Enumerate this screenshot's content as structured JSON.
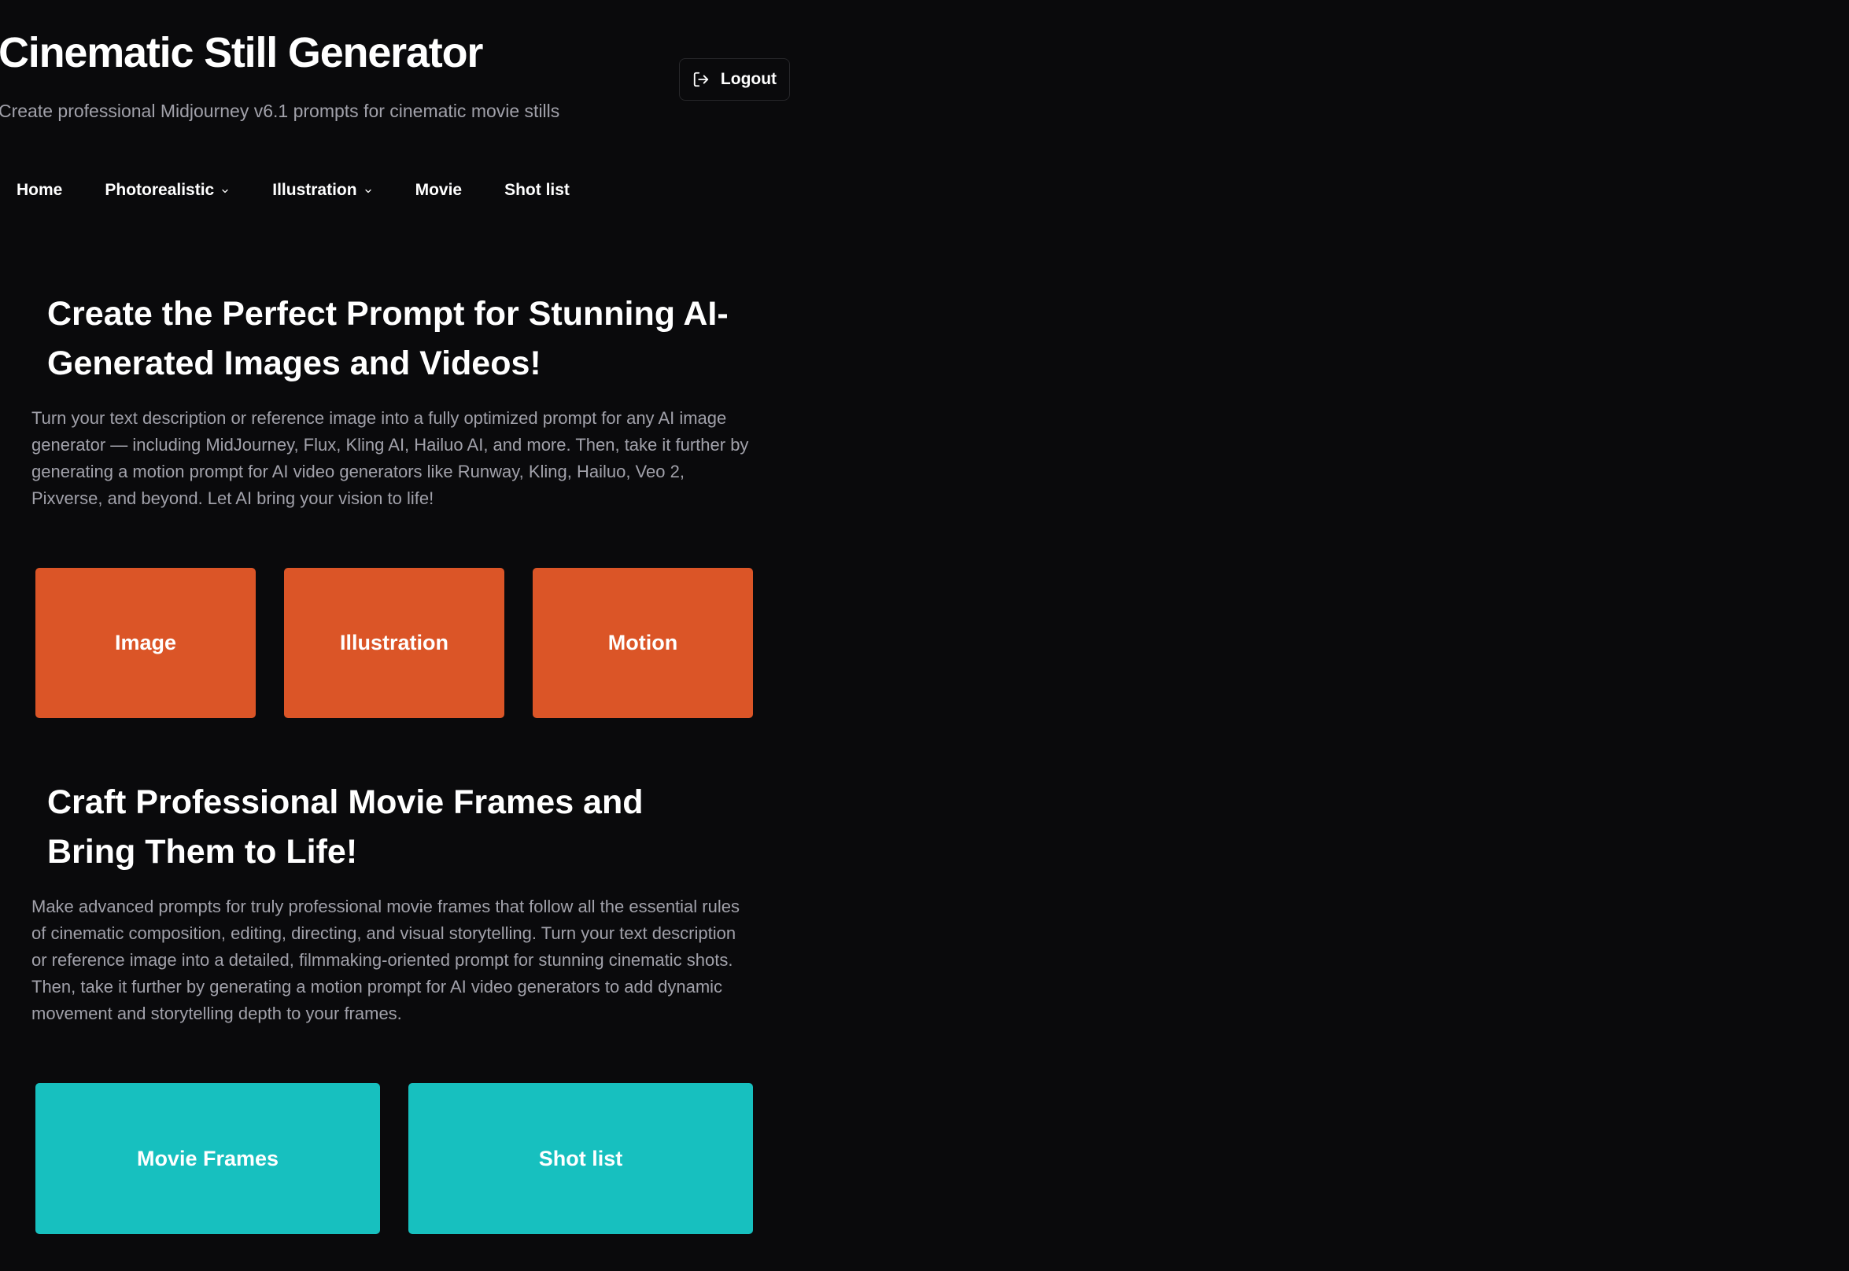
{
  "header": {
    "title": "Cinematic Still Generator",
    "subtitle": "Create professional Midjourney v6.1 prompts for cinematic movie stills",
    "logout_label": "Logout",
    "logout_icon": "logout-icon"
  },
  "nav": {
    "items": [
      {
        "label": "Home",
        "has_dropdown": false
      },
      {
        "label": "Photorealistic",
        "has_dropdown": true
      },
      {
        "label": "Illustration",
        "has_dropdown": true
      },
      {
        "label": "Movie",
        "has_dropdown": false
      },
      {
        "label": "Shot list",
        "has_dropdown": false
      }
    ]
  },
  "section1": {
    "heading": "Create the Perfect Prompt for Stunning AI-Generated Images and Videos!",
    "description": "Turn your text description or reference image into a fully optimized prompt for any AI image generator — including MidJourney, Flux, Kling AI, Hailuo AI, and more. Then, take it further by generating a motion prompt for AI video generators like Runway, Kling, Hailuo, Veo 2, Pixverse, and beyond. Let AI bring your vision to life!",
    "cards": [
      {
        "label": "Image"
      },
      {
        "label": "Illustration"
      },
      {
        "label": "Motion"
      }
    ]
  },
  "section2": {
    "heading": "Craft Professional Movie Frames and Bring Them to Life!",
    "description": "Make advanced prompts for truly professional movie frames that follow all the essential rules of cinematic composition, editing, directing, and visual storytelling. Turn your text description or reference image into a detailed, filmmaking-oriented prompt for stunning cinematic shots. Then, take it further by generating a motion prompt for AI video generators to add dynamic movement and storytelling depth to your frames.",
    "cards": [
      {
        "label": "Movie Frames"
      },
      {
        "label": "Shot list"
      }
    ]
  },
  "colors": {
    "background": "#0a0a0c",
    "accent_orange": "#db5527",
    "accent_teal": "#17c0bf",
    "muted_text": "#a1a1aa",
    "border": "#27272a"
  }
}
